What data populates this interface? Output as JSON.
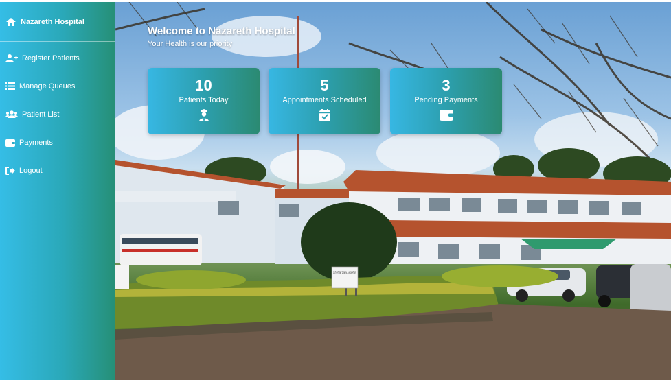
{
  "sidebar": {
    "brand": {
      "label": "Nazareth Hospital",
      "icon": "home-icon"
    },
    "items": [
      {
        "label": "Register Patients",
        "icon": "user-plus-icon"
      },
      {
        "label": "Manage Queues",
        "icon": "list-icon"
      },
      {
        "label": "Patient List",
        "icon": "users-icon"
      },
      {
        "label": "Payments",
        "icon": "wallet-icon"
      },
      {
        "label": "Logout",
        "icon": "logout-icon"
      }
    ]
  },
  "main": {
    "welcome_title": "Welcome to Nazareth Hospital",
    "welcome_subtitle": "Your Health is our priority",
    "sign_text": "OUT-PATIENT DENTAL LABORATORY",
    "cards": [
      {
        "value": "10",
        "label": "Patients Today",
        "icon": "user-nurse-icon"
      },
      {
        "value": "5",
        "label": "Appointments Scheduled",
        "icon": "calendar-check-icon"
      },
      {
        "value": "3",
        "label": "Pending Payments",
        "icon": "wallet-icon"
      }
    ]
  },
  "colors": {
    "sidebar_start": "#35bde6",
    "sidebar_end": "#268f76",
    "card_start": "#37b7e3",
    "card_end": "#2b8a72"
  }
}
